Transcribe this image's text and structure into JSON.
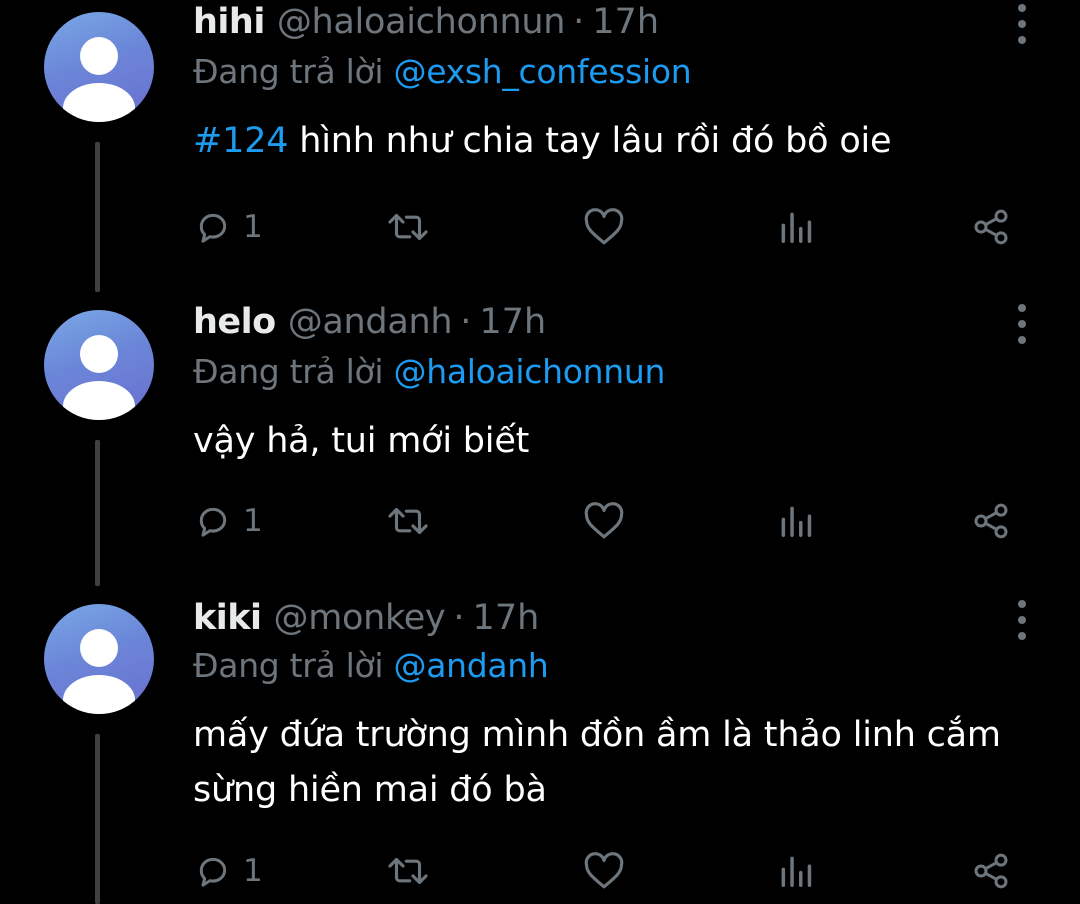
{
  "colors": {
    "background": "#000000",
    "text": "#ffffff",
    "muted": "#6e767d",
    "accent": "#1d9bf0"
  },
  "replying_prefix": "Đang trả lời",
  "tweets": [
    {
      "name": "hihi",
      "handle": "@haloaichonnun",
      "separator": "·",
      "time": "17h",
      "reply_to": "@exsh_confession",
      "hashtag": "#124",
      "text": " hình như chia tay lâu rồi đó bồ oie",
      "reply_count": "1",
      "icons": [
        "reply-icon",
        "retweet-icon",
        "like-icon",
        "analytics-icon",
        "share-icon",
        "more-icon"
      ]
    },
    {
      "name": "helo",
      "handle": "@andanh",
      "separator": "·",
      "time": "17h",
      "reply_to": "@haloaichonnun",
      "text": "vậy hả, tui mới biết",
      "reply_count": "1"
    },
    {
      "name": "kiki",
      "handle": "@monkey",
      "separator": "·",
      "time": "17h",
      "reply_to": "@andanh",
      "text": "mấy đứa trường mình đồn ầm là thảo linh cắm sừng hiền mai đó bà",
      "reply_count": "1"
    }
  ]
}
